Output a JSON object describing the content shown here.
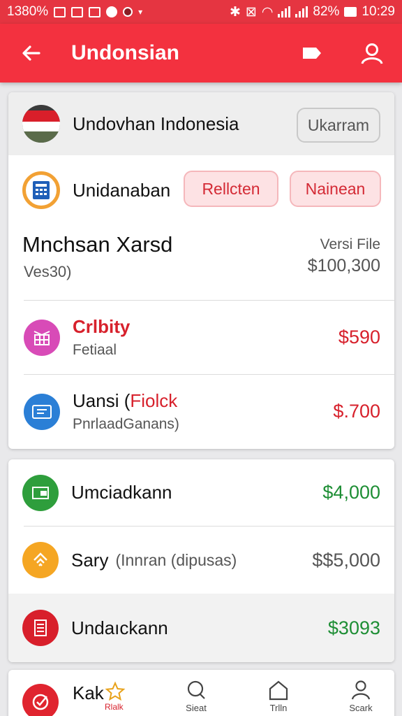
{
  "status_bar": {
    "left_text": "1380%",
    "battery_text": "82%",
    "time": "10:29"
  },
  "app_bar": {
    "title": "Undonsian",
    "icons": [
      "back-arrow-icon",
      "label-tag-icon",
      "profile-icon"
    ]
  },
  "header_card": {
    "title": "Undovhan Indonesia",
    "button_label": "Ukarram"
  },
  "action_row": {
    "title": "Unidanaban",
    "button1_label": "Rellcten",
    "button2_label": "Nainean"
  },
  "summary": {
    "title": "Mnchsan Xarsd",
    "subtitle": "Ves30)",
    "right_label": "Versi File",
    "right_value": "$100,300"
  },
  "card1_items": [
    {
      "title": "Crlbity",
      "subtitle": "Fetiaal",
      "amount": "$590",
      "icon": "calendar-grid-icon",
      "color": "#d84bb7"
    },
    {
      "title": "Uansi (",
      "title_accent": "Fiolck",
      "subtitle": "PnrlaadGanans)",
      "amount": "$.700",
      "icon": "window-card-icon",
      "color": "#2b7fd6"
    }
  ],
  "card2_items": [
    {
      "title": "Umciadkann",
      "subtitle": "",
      "amount": "$4,000",
      "amount_color": "#1e8e35",
      "icon": "wallet-icon",
      "color": "#2e9e3c"
    },
    {
      "title": "Sary",
      "subtitle": "(Innran (dipusas)",
      "amount": "$$5,000",
      "amount_color": "#555555",
      "icon": "stripes-icon",
      "color": "#f5a623"
    },
    {
      "title": "Undaıckann",
      "subtitle": "",
      "amount": "$3093",
      "amount_color": "#1e8e35",
      "icon": "list-doc-icon",
      "color": "#d81f2b"
    }
  ],
  "card3": {
    "title": "Kak",
    "sub_red": "Rlalk",
    "icon": "target-check-icon"
  },
  "bottom_nav": [
    {
      "label": "Sieat",
      "icon": "search-icon"
    },
    {
      "label": "Trlln",
      "icon": "home-icon"
    },
    {
      "label": "Scark",
      "icon": "person-icon"
    }
  ],
  "colors": {
    "primary": "#f3313f",
    "status_bar": "#e53541",
    "accent_red": "#d7212c",
    "accent_green": "#1e8e35"
  }
}
